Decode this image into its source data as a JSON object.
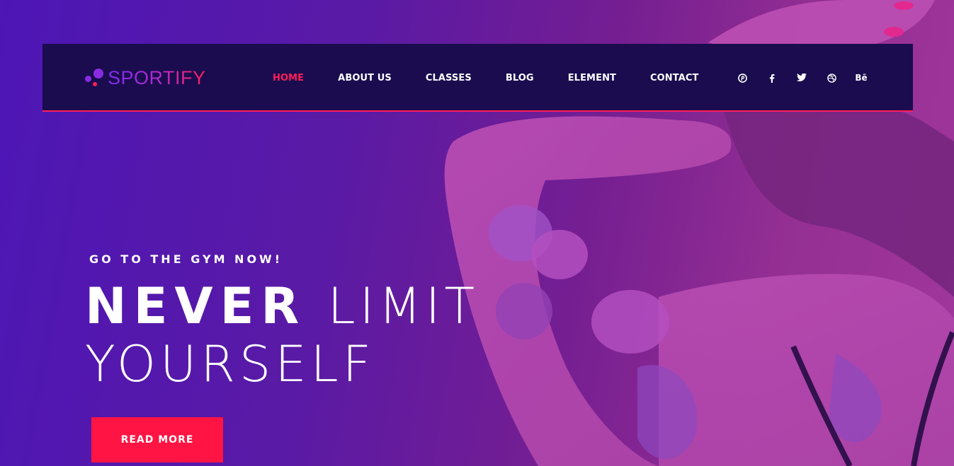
{
  "brand": {
    "name": "SPORTIFY",
    "accent": "#ff1e56",
    "primary": "#8a2be2",
    "nav_bg": "#1a0c4f"
  },
  "nav": {
    "items": [
      {
        "label": "HOME",
        "active": true
      },
      {
        "label": "ABOUT US",
        "active": false
      },
      {
        "label": "CLASSES",
        "active": false
      },
      {
        "label": "BLOG",
        "active": false
      },
      {
        "label": "ELEMENT",
        "active": false
      },
      {
        "label": "CONTACT",
        "active": false
      }
    ]
  },
  "social": [
    {
      "icon": "pinterest-icon"
    },
    {
      "icon": "facebook-icon"
    },
    {
      "icon": "twitter-icon"
    },
    {
      "icon": "dribbble-icon"
    },
    {
      "icon": "behance-icon",
      "glyph": "Bē"
    }
  ],
  "hero": {
    "kicker": "GO TO THE GYM NOW!",
    "headline_bold": "NEVER",
    "headline_light_1": "LIMIT",
    "headline_light_2": "YOURSELF",
    "cta_label": "READ MORE"
  }
}
